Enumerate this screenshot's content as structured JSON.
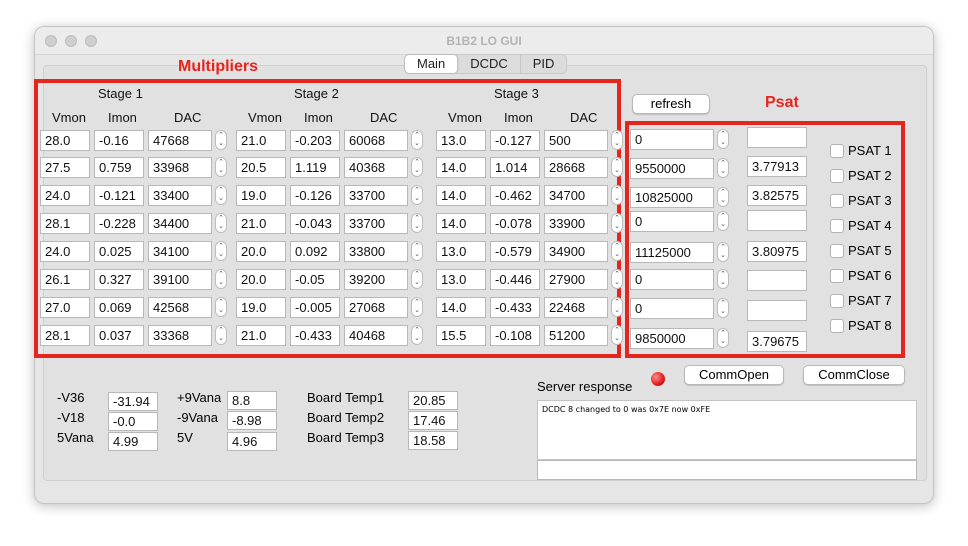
{
  "window": {
    "title": "B1B2 LO GUI"
  },
  "tabs": [
    {
      "label": "Main",
      "active": true
    },
    {
      "label": "DCDC",
      "active": false
    },
    {
      "label": "PID",
      "active": false
    }
  ],
  "annotations": {
    "multipliers": "Multipliers",
    "psat": "Psat",
    "color": "#e5261f"
  },
  "stages": [
    {
      "title": "Stage 1",
      "cols": [
        "Vmon",
        "Imon",
        "DAC"
      ],
      "rows": [
        [
          "28.0",
          "-0.16",
          "47668"
        ],
        [
          "27.5",
          "0.759",
          "33968"
        ],
        [
          "24.0",
          "-0.121",
          "33400"
        ],
        [
          "28.1",
          "-0.228",
          "34400"
        ],
        [
          "24.0",
          "0.025",
          "34100"
        ],
        [
          "26.1",
          "0.327",
          "39100"
        ],
        [
          "27.0",
          "0.069",
          "42568"
        ],
        [
          "28.1",
          "0.037",
          "33368"
        ]
      ]
    },
    {
      "title": "Stage 2",
      "cols": [
        "Vmon",
        "Imon",
        "DAC"
      ],
      "rows": [
        [
          "21.0",
          "-0.203",
          "60068"
        ],
        [
          "20.5",
          "1.119",
          "40368"
        ],
        [
          "19.0",
          "-0.126",
          "33700"
        ],
        [
          "21.0",
          "-0.043",
          "33700"
        ],
        [
          "20.0",
          "0.092",
          "33800"
        ],
        [
          "20.0",
          "-0.05",
          "39200"
        ],
        [
          "19.0",
          "-0.005",
          "27068"
        ],
        [
          "21.0",
          "-0.433",
          "40468"
        ]
      ]
    },
    {
      "title": "Stage 3",
      "cols": [
        "Vmon",
        "Imon",
        "DAC"
      ],
      "rows": [
        [
          "13.0",
          "-0.127",
          "500"
        ],
        [
          "14.0",
          "1.014",
          "28668"
        ],
        [
          "14.0",
          "-0.462",
          "34700"
        ],
        [
          "14.0",
          "-0.078",
          "33900"
        ],
        [
          "13.0",
          "-0.579",
          "34900"
        ],
        [
          "13.0",
          "-0.446",
          "27900"
        ],
        [
          "14.0",
          "-0.433",
          "22468"
        ],
        [
          "15.5",
          "-0.108",
          "51200"
        ]
      ]
    }
  ],
  "psat": {
    "refresh_label": "refresh",
    "rows": [
      {
        "setpoint": "0",
        "readback": "",
        "label": "PSAT 1"
      },
      {
        "setpoint": "9550000",
        "readback": "3.77913",
        "label": "PSAT 2"
      },
      {
        "setpoint": "10825000",
        "readback": "3.82575",
        "label": "PSAT 3"
      },
      {
        "setpoint": "0",
        "readback": "",
        "label": "PSAT 4"
      },
      {
        "setpoint": "11125000",
        "readback": "3.80975",
        "label": "PSAT 5"
      },
      {
        "setpoint": "0",
        "readback": "",
        "label": "PSAT 6"
      },
      {
        "setpoint": "0",
        "readback": "",
        "label": "PSAT 7"
      },
      {
        "setpoint": "9850000",
        "readback": "3.79675",
        "label": "PSAT 8"
      }
    ]
  },
  "voltages": [
    {
      "label": "-V36",
      "value": "-31.94"
    },
    {
      "label": "-V18",
      "value": "-0.0"
    },
    {
      "label": "5Vana",
      "value": "4.99"
    },
    {
      "label": "+9Vana",
      "value": "8.8"
    },
    {
      "label": "-9Vana",
      "value": "-8.98"
    },
    {
      "label": "5V",
      "value": "4.96"
    }
  ],
  "temps": [
    {
      "label": "Board Temp1",
      "value": "20.85"
    },
    {
      "label": "Board Temp2",
      "value": "17.46"
    },
    {
      "label": "Board Temp3",
      "value": "18.58"
    }
  ],
  "server": {
    "label": "Server response",
    "comm_open": "CommOpen",
    "comm_close": "CommClose",
    "response_text": "DCDC 8 changed to 0 was 0x7E now 0xFE",
    "command_value": ""
  }
}
